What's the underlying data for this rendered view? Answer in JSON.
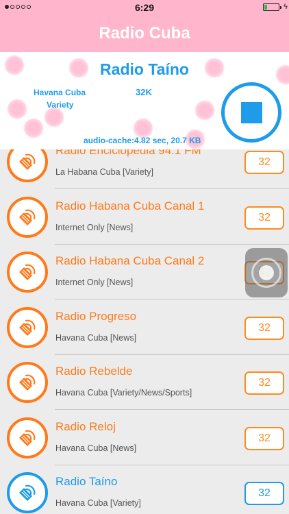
{
  "status_bar": {
    "time": "6:29",
    "signal_bars": 1,
    "battery_level": 0.2
  },
  "nav": {
    "title": "Radio Cuba"
  },
  "player": {
    "station_name": "Radio Taíno",
    "location": "Havana Cuba",
    "genre": "Variety",
    "bitrate": "32K",
    "cache_info": "audio-cache:4.82 sec, 20.7 KB",
    "stop_icon": "stop-icon"
  },
  "colors": {
    "pink": "#ffb6cc",
    "blue": "#1e9be9",
    "orange": "#ff7a1a"
  },
  "stations": [
    {
      "name": "Radio Enciclopedia 94.1 FM",
      "desc": "La Habana Cuba [Variety]",
      "bitrate": "32",
      "active": false
    },
    {
      "name": "Radio Habana Cuba Canal 1",
      "desc": "Internet Only [News]",
      "bitrate": "32",
      "active": false
    },
    {
      "name": "Radio Habana Cuba Canal 2",
      "desc": "Internet Only [News]",
      "bitrate": "32",
      "active": false
    },
    {
      "name": "Radio Progreso",
      "desc": "Havana Cuba [News]",
      "bitrate": "32",
      "active": false
    },
    {
      "name": "Radio Rebelde",
      "desc": "Havana Cuba [Variety/News/Sports]",
      "bitrate": "32",
      "active": false
    },
    {
      "name": "Radio Reloj",
      "desc": "Havana Cuba [News]",
      "bitrate": "32",
      "active": false
    },
    {
      "name": "Radio Taíno",
      "desc": "Havana Cuba [Variety]",
      "bitrate": "32",
      "active": true
    }
  ]
}
